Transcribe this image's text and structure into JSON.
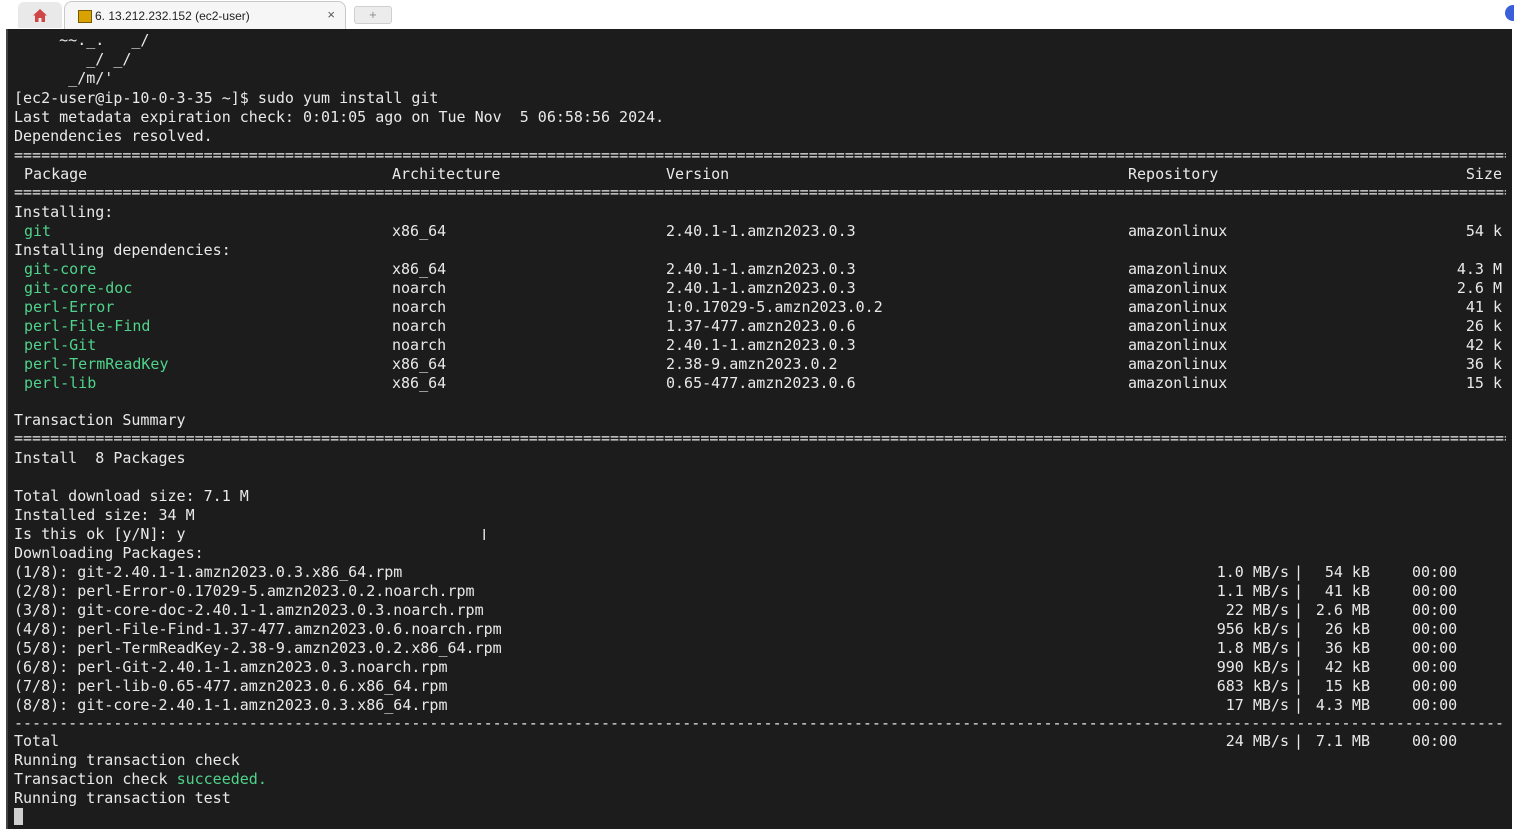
{
  "tab": {
    "title": "6. 13.212.232.152 (ec2-user)",
    "close": "×",
    "new_tab": "+"
  },
  "icons": [
    "home-icon",
    "terminal-icon",
    "close-icon"
  ],
  "colors": {
    "terminal_bg": "#1c1c1c",
    "text": "#e9e9e9",
    "package_green": "#4fd38a"
  },
  "terminal": {
    "banner": [
      "     ~~._.   _/",
      "        _/ _/",
      "      _/m/'"
    ],
    "prompt": "[ec2-user@ip-10-0-3-35 ~]$ sudo yum install git",
    "metadata": "Last metadata expiration check: 0:01:05 ago on Tue Nov  5 06:58:56 2024.",
    "deps_resolved": "Dependencies resolved.",
    "headers": {
      "package": "Package",
      "arch": "Architecture",
      "version": "Version",
      "repo": "Repository",
      "size": "Size"
    },
    "installing_label": "Installing:",
    "deps_label": "Installing dependencies:",
    "installing": [
      {
        "name": "git",
        "arch": "x86_64",
        "version": "2.40.1-1.amzn2023.0.3",
        "repo": "amazonlinux",
        "size": "54 k"
      }
    ],
    "dependencies": [
      {
        "name": "git-core",
        "arch": "x86_64",
        "version": "2.40.1-1.amzn2023.0.3",
        "repo": "amazonlinux",
        "size": "4.3 M"
      },
      {
        "name": "git-core-doc",
        "arch": "noarch",
        "version": "2.40.1-1.amzn2023.0.3",
        "repo": "amazonlinux",
        "size": "2.6 M"
      },
      {
        "name": "perl-Error",
        "arch": "noarch",
        "version": "1:0.17029-5.amzn2023.0.2",
        "repo": "amazonlinux",
        "size": "41 k"
      },
      {
        "name": "perl-File-Find",
        "arch": "noarch",
        "version": "1.37-477.amzn2023.0.6",
        "repo": "amazonlinux",
        "size": "26 k"
      },
      {
        "name": "perl-Git",
        "arch": "noarch",
        "version": "2.40.1-1.amzn2023.0.3",
        "repo": "amazonlinux",
        "size": "42 k"
      },
      {
        "name": "perl-TermReadKey",
        "arch": "x86_64",
        "version": "2.38-9.amzn2023.0.2",
        "repo": "amazonlinux",
        "size": "36 k"
      },
      {
        "name": "perl-lib",
        "arch": "x86_64",
        "version": "0.65-477.amzn2023.0.6",
        "repo": "amazonlinux",
        "size": "15 k"
      }
    ],
    "summary_title": "Transaction Summary",
    "install_count": "Install  8 Packages",
    "download_size": "Total download size: 7.1 M",
    "installed_size": "Installed size: 34 M",
    "confirm": "Is this ok [y/N]: y",
    "downloading": "Downloading Packages:",
    "downloads": [
      {
        "file": "(1/8): git-2.40.1-1.amzn2023.0.3.x86_64.rpm",
        "rate": "1.0 MB/s",
        "size": "54 kB",
        "time": "00:00"
      },
      {
        "file": "(2/8): perl-Error-0.17029-5.amzn2023.0.2.noarch.rpm",
        "rate": "1.1 MB/s",
        "size": "41 kB",
        "time": "00:00"
      },
      {
        "file": "(3/8): git-core-doc-2.40.1-1.amzn2023.0.3.noarch.rpm",
        "rate": "22 MB/s",
        "size": "2.6 MB",
        "time": "00:00"
      },
      {
        "file": "(4/8): perl-File-Find-1.37-477.amzn2023.0.6.noarch.rpm",
        "rate": "956 kB/s",
        "size": "26 kB",
        "time": "00:00"
      },
      {
        "file": "(5/8): perl-TermReadKey-2.38-9.amzn2023.0.2.x86_64.rpm",
        "rate": "1.8 MB/s",
        "size": "36 kB",
        "time": "00:00"
      },
      {
        "file": "(6/8): perl-Git-2.40.1-1.amzn2023.0.3.noarch.rpm",
        "rate": "990 kB/s",
        "size": "42 kB",
        "time": "00:00"
      },
      {
        "file": "(7/8): perl-lib-0.65-477.amzn2023.0.6.x86_64.rpm",
        "rate": "683 kB/s",
        "size": "15 kB",
        "time": "00:00"
      },
      {
        "file": "(8/8): git-core-2.40.1-1.amzn2023.0.3.x86_64.rpm",
        "rate": "17 MB/s",
        "size": "4.3 MB",
        "time": "00:00"
      }
    ],
    "pipe": "|",
    "total": {
      "label": "Total",
      "rate": "24 MB/s",
      "size": "7.1 MB",
      "time": "00:00"
    },
    "check_running": "Running transaction check",
    "check_prefix": "Transaction check ",
    "check_result": "succeeded.",
    "test_running": "Running transaction test"
  }
}
